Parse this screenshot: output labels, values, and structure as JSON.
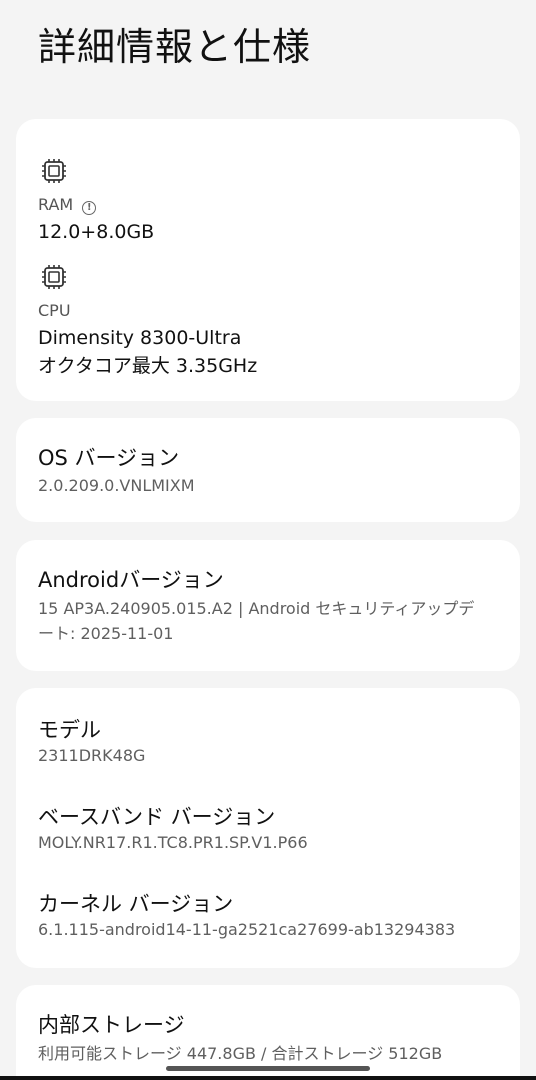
{
  "header": {
    "title": "詳細情報と仕様"
  },
  "hardware": {
    "ram": {
      "icon": "chip-icon",
      "label": "RAM",
      "info_icon": "info-circle-icon",
      "info_glyph": "!",
      "value": "12.0+8.0GB"
    },
    "cpu": {
      "icon": "cpu-icon",
      "label": "CPU",
      "value_line1": "Dimensity 8300-Ultra",
      "value_line2": "オクタコア最大 3.35GHz"
    }
  },
  "os_version": {
    "title": "OS バージョン",
    "value": "2.0.209.0.VNLMIXM"
  },
  "android_version": {
    "title": "Androidバージョン",
    "value_line1": "15 AP3A.240905.015.A2 | Android セキュリティアップデ",
    "value_line2": "ート: 2025-11-01"
  },
  "device": {
    "model_title": "モデル",
    "model_value": "2311DRK48G",
    "baseband_title": "ベースバンド バージョン",
    "baseband_value": "MOLY.NR17.R1.TC8.PR1.SP.V1.P66",
    "kernel_title": "カーネル バージョン",
    "kernel_value": "6.1.115-android14-11-ga2521ca27699-ab13294383"
  },
  "storage": {
    "title": "内部ストレージ",
    "value": "利用可能ストレージ  447.8GB / 合計ストレージ  512GB"
  },
  "colors": {
    "background": "#f4f4f4",
    "card": "#ffffff",
    "text_primary": "#111111",
    "text_secondary": "#5f5f5f"
  }
}
